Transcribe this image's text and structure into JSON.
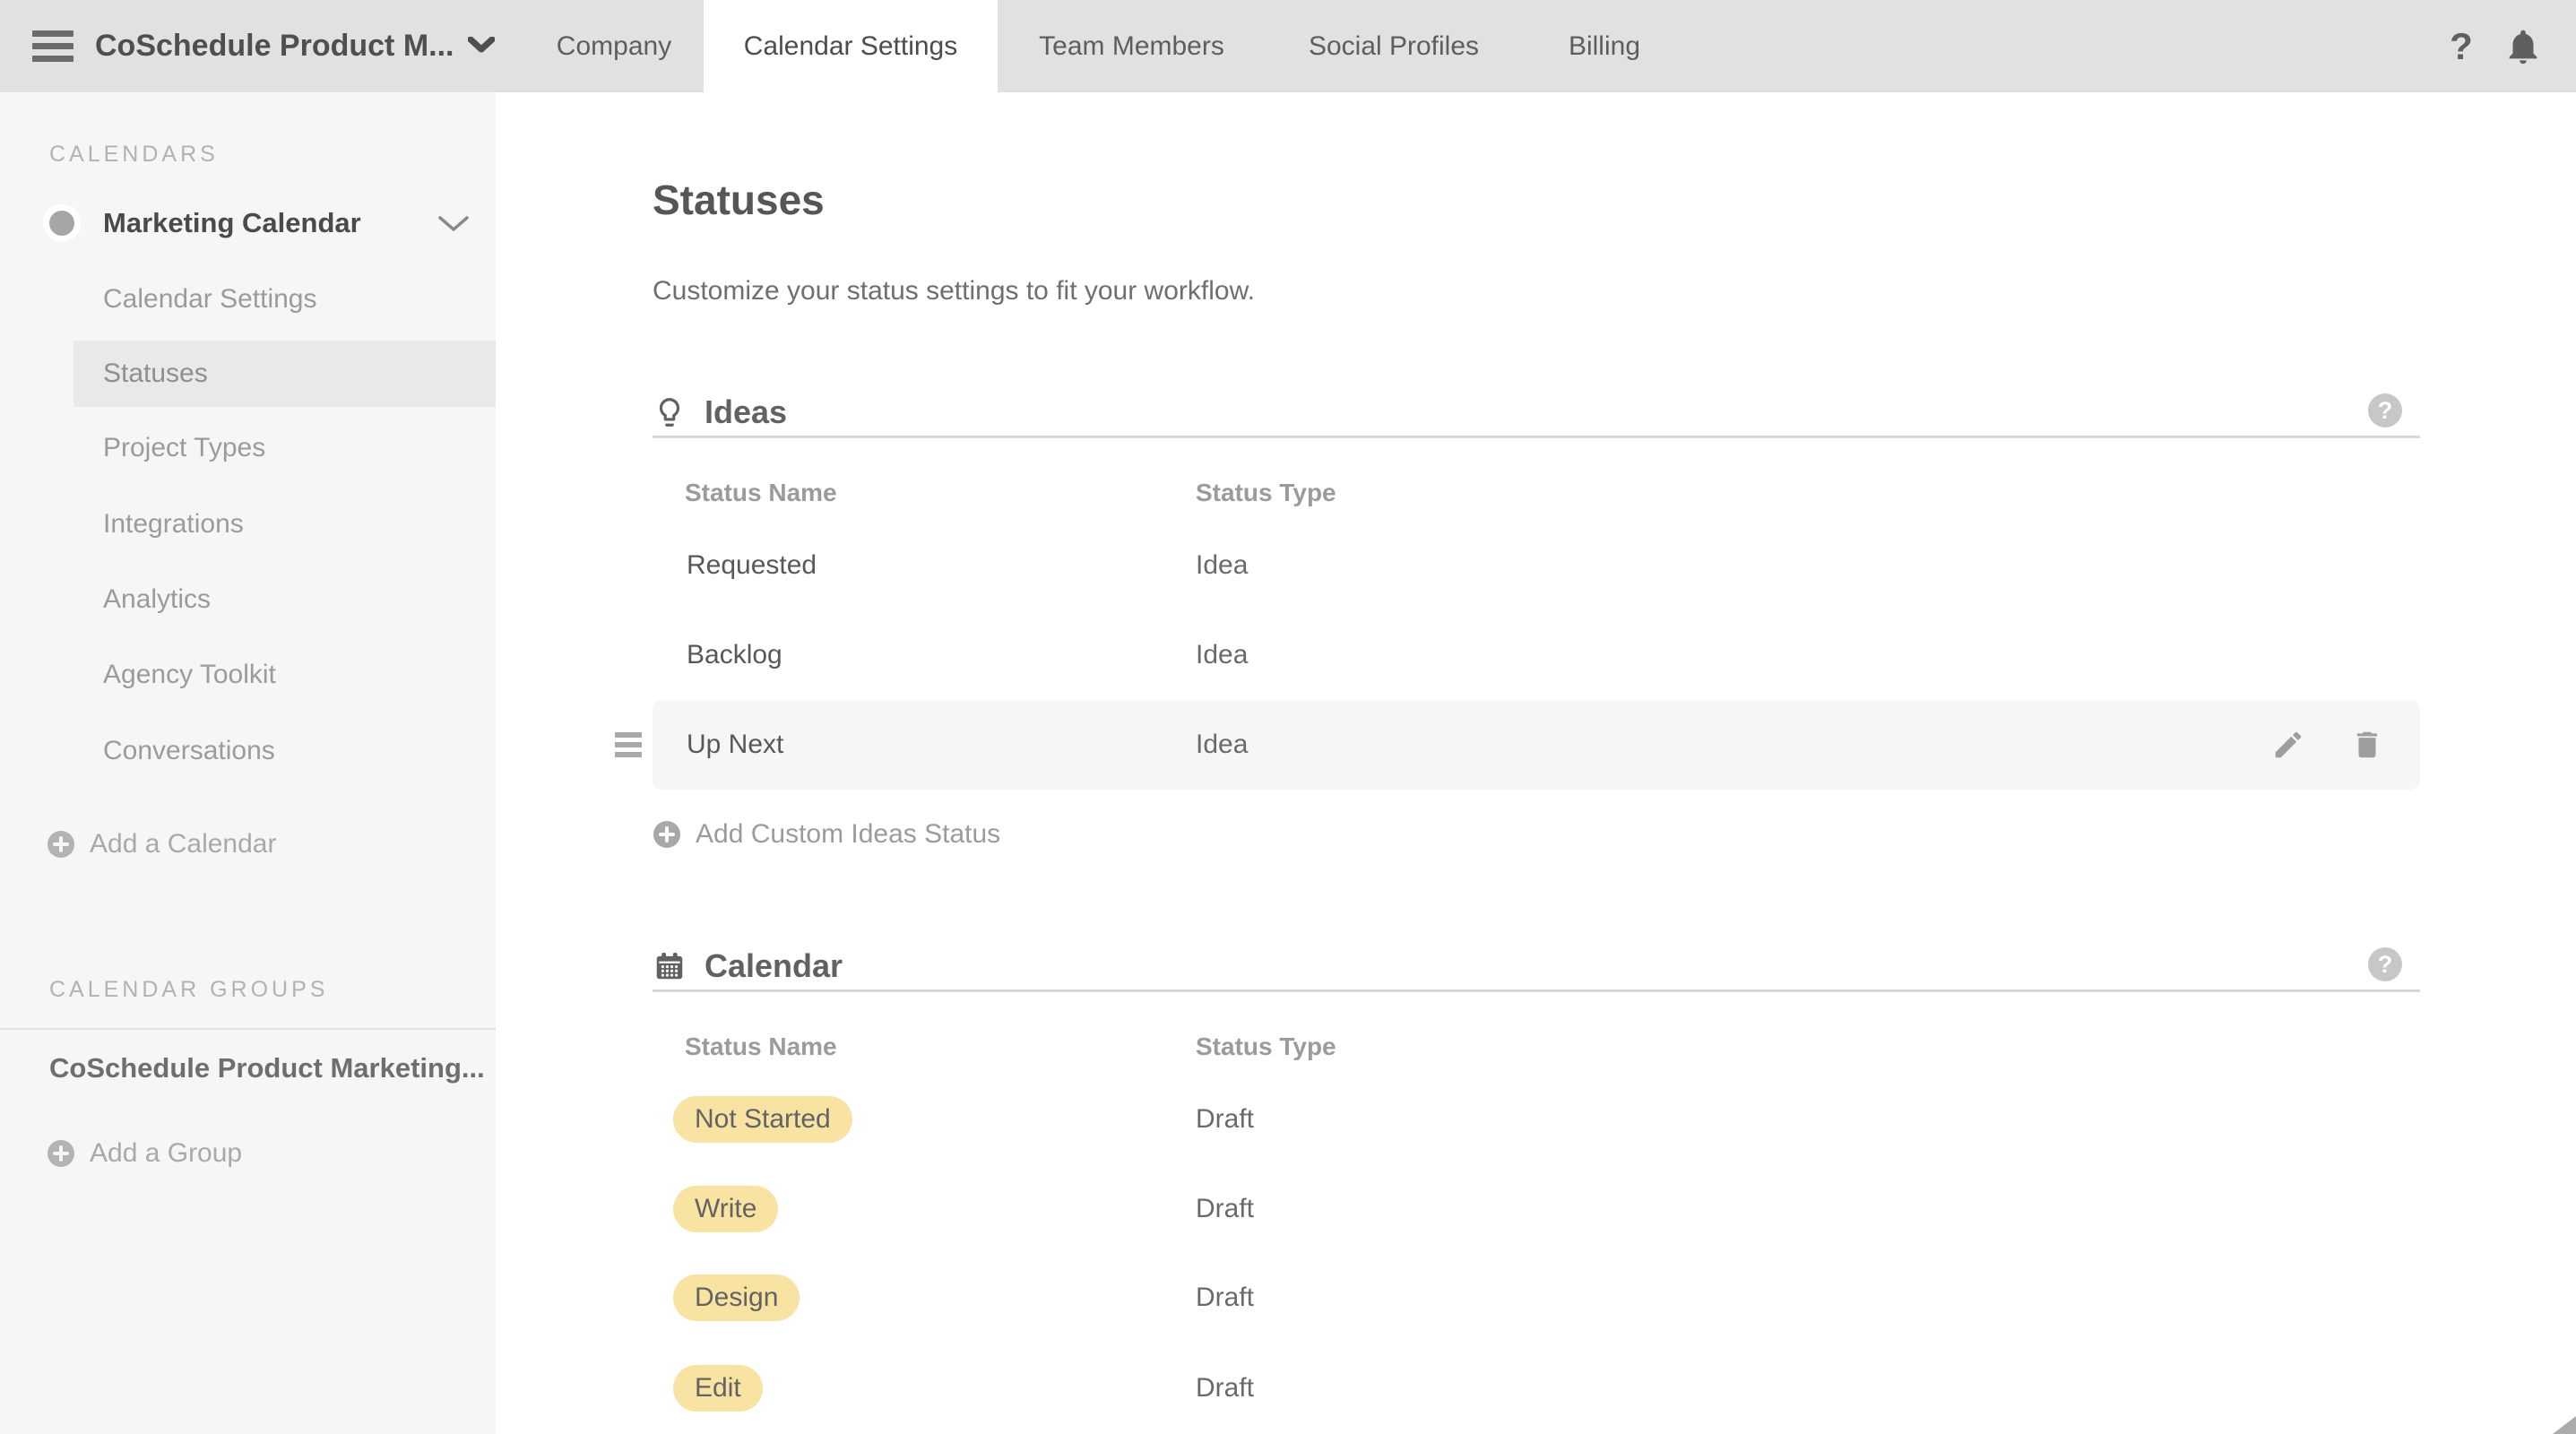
{
  "colors": {
    "topbar_bg": "#E1E1E1",
    "sidebar_bg": "#F6F6F6",
    "selected_bg": "#E9E9E9",
    "hover_row_bg": "#F6F6F6",
    "badge_bg": "#F8E3A3",
    "divider": "#D8D8D8"
  },
  "topbar": {
    "title": "CoSchedule Product M...",
    "help_glyph": "?",
    "tabs": [
      {
        "label": "Company"
      },
      {
        "label": "Calendar Settings"
      },
      {
        "label": "Team Members"
      },
      {
        "label": "Social Profiles"
      },
      {
        "label": "Billing"
      }
    ]
  },
  "sidebar": {
    "calendars_label": "CALENDARS",
    "calendar_name": "Marketing Calendar",
    "items": [
      {
        "label": "Calendar Settings"
      },
      {
        "label": "Statuses",
        "selected": true
      },
      {
        "label": "Project Types"
      },
      {
        "label": "Integrations"
      },
      {
        "label": "Analytics"
      },
      {
        "label": "Agency Toolkit"
      },
      {
        "label": "Conversations"
      }
    ],
    "add_calendar_label": "Add a Calendar",
    "groups_label": "CALENDAR GROUPS",
    "group_name": "CoSchedule Product Marketing...",
    "add_group_label": "Add a Group"
  },
  "main": {
    "title": "Statuses",
    "subtitle": "Customize your status settings to fit your workflow.",
    "help_glyph": "?",
    "sections": [
      {
        "title": "Ideas",
        "icon": "lightbulb-icon",
        "columns": [
          "Status Name",
          "Status Type"
        ],
        "rows": [
          {
            "name": "Requested",
            "type": "Idea"
          },
          {
            "name": "Backlog",
            "type": "Idea"
          },
          {
            "name": "Up Next",
            "type": "Idea",
            "hovered": true
          }
        ],
        "add_label": "Add Custom Ideas Status"
      },
      {
        "title": "Calendar",
        "icon": "calendar-icon",
        "columns": [
          "Status Name",
          "Status Type"
        ],
        "rows": [
          {
            "name": "Not Started",
            "type": "Draft"
          },
          {
            "name": "Write",
            "type": "Draft"
          },
          {
            "name": "Design",
            "type": "Draft"
          },
          {
            "name": "Edit",
            "type": "Draft"
          }
        ]
      }
    ]
  }
}
